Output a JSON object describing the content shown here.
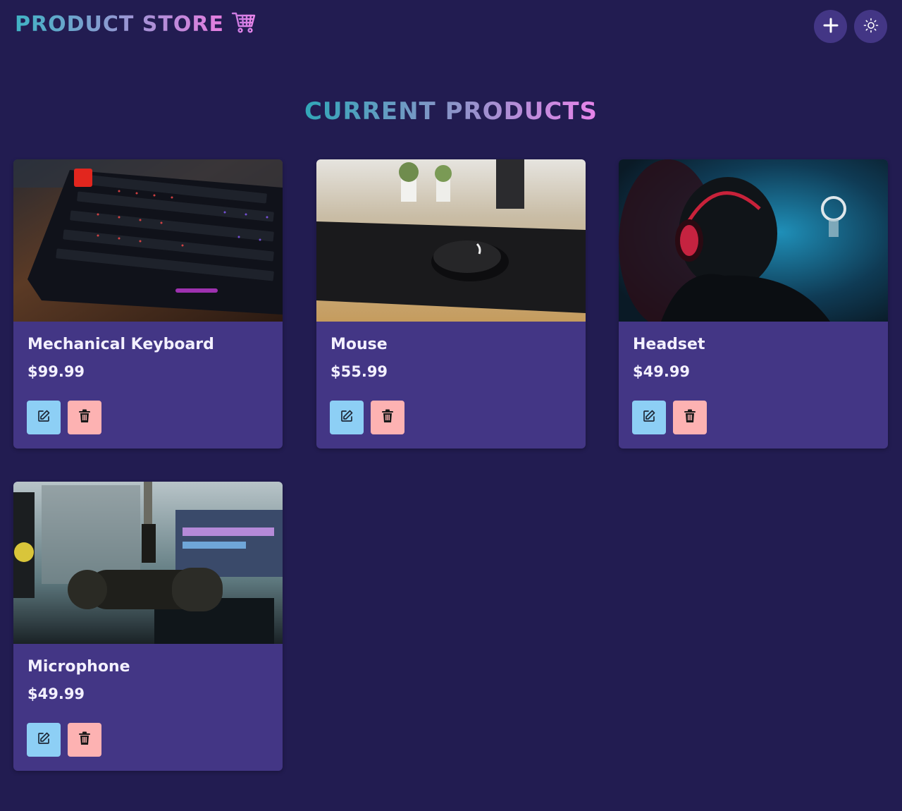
{
  "app": {
    "brand_title": "PRODUCT STORE",
    "brand_icon": "shopping-cart-icon",
    "add_icon": "plus-icon",
    "theme_icon": "sun-icon"
  },
  "main": {
    "heading": "CURRENT PRODUCTS"
  },
  "products": [
    {
      "name": "Mechanical Keyboard",
      "price": "$99.99",
      "image": "keyboard-photo"
    },
    {
      "name": "Mouse",
      "price": "$55.99",
      "image": "mouse-photo"
    },
    {
      "name": "Headset",
      "price": "$49.99",
      "image": "headset-photo"
    },
    {
      "name": "Microphone",
      "price": "$49.99",
      "image": "microphone-photo"
    }
  ],
  "colors": {
    "background": "#221c51",
    "card": "#433685",
    "edit_button": "#8dcff5",
    "delete_button": "#fdb2b2"
  }
}
